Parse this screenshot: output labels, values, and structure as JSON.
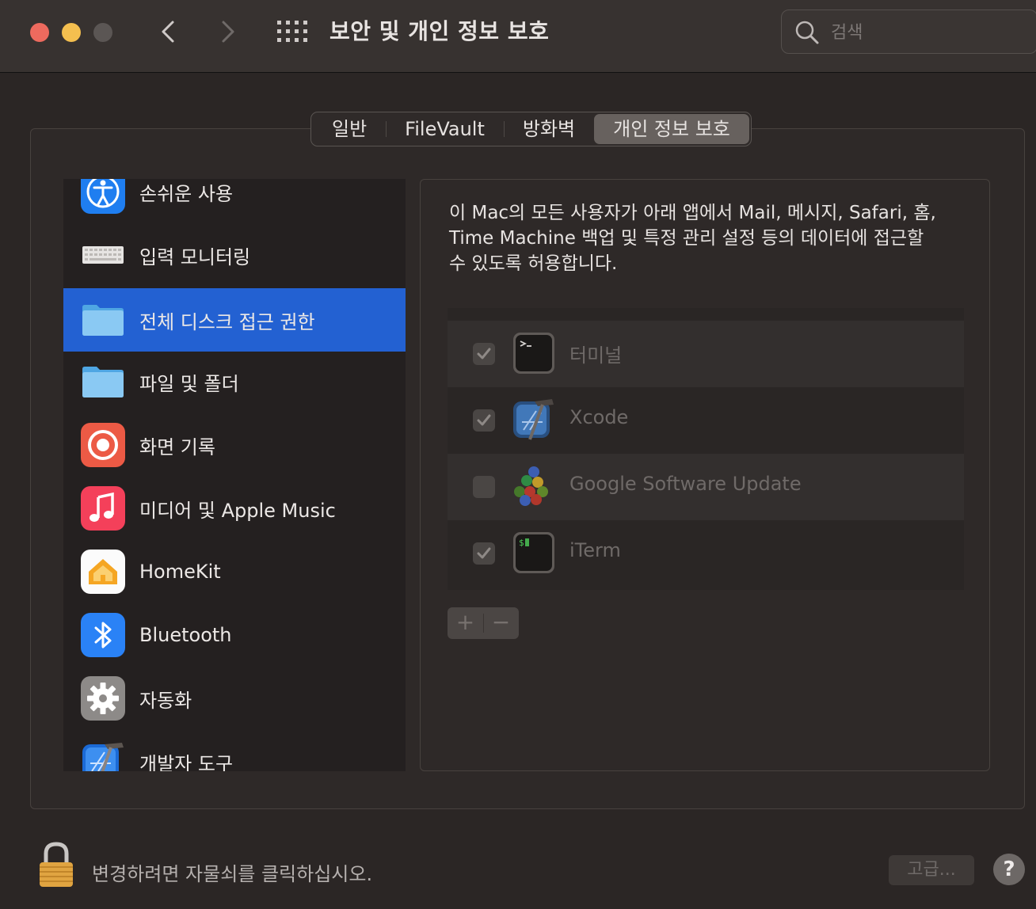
{
  "window": {
    "title": "보안 및 개인 정보 보호",
    "search_placeholder": "검색"
  },
  "tabs": [
    {
      "label": "일반",
      "active": false
    },
    {
      "label": "FileVault",
      "active": false
    },
    {
      "label": "방화벽",
      "active": false
    },
    {
      "label": "개인 정보 보호",
      "active": true
    }
  ],
  "sidebar": {
    "items": [
      {
        "label": "손쉬운 사용",
        "icon": "accessibility-icon",
        "selected": false
      },
      {
        "label": "입력 모니터링",
        "icon": "keyboard-icon",
        "selected": false
      },
      {
        "label": "전체 디스크 접근 권한",
        "icon": "folder-icon",
        "selected": true
      },
      {
        "label": "파일 및 폴더",
        "icon": "folder-icon",
        "selected": false
      },
      {
        "label": "화면 기록",
        "icon": "screen-record-icon",
        "selected": false
      },
      {
        "label": "미디어 및 Apple Music",
        "icon": "music-icon",
        "selected": false
      },
      {
        "label": "HomeKit",
        "icon": "home-icon",
        "selected": false
      },
      {
        "label": "Bluetooth",
        "icon": "bluetooth-icon",
        "selected": false
      },
      {
        "label": "자동화",
        "icon": "gear-icon",
        "selected": false
      },
      {
        "label": "개발자 도구",
        "icon": "xcode-icon",
        "selected": false
      }
    ]
  },
  "main": {
    "description_lines": [
      "이 Mac의 모든 사용자가 아래 앱에서 Mail, 메시지, Safari, 홈,",
      "Time Machine 백업 및 특정 관리 설정 등의 데이터에 접근할",
      "수 있도록 허용합니다."
    ],
    "apps": [
      {
        "name": "터미널",
        "checked": true,
        "icon": "terminal-icon"
      },
      {
        "name": "Xcode",
        "checked": true,
        "icon": "xcode-icon"
      },
      {
        "name": "Google Software Update",
        "checked": false,
        "icon": "google-software-update-icon"
      },
      {
        "name": "iTerm",
        "checked": true,
        "icon": "iterm-icon"
      }
    ],
    "add_label": "+",
    "remove_label": "−"
  },
  "footer": {
    "lock_text": "변경하려면 자물쇠를 클릭하십시오.",
    "advanced_label": "고급...",
    "help_label": "?"
  }
}
